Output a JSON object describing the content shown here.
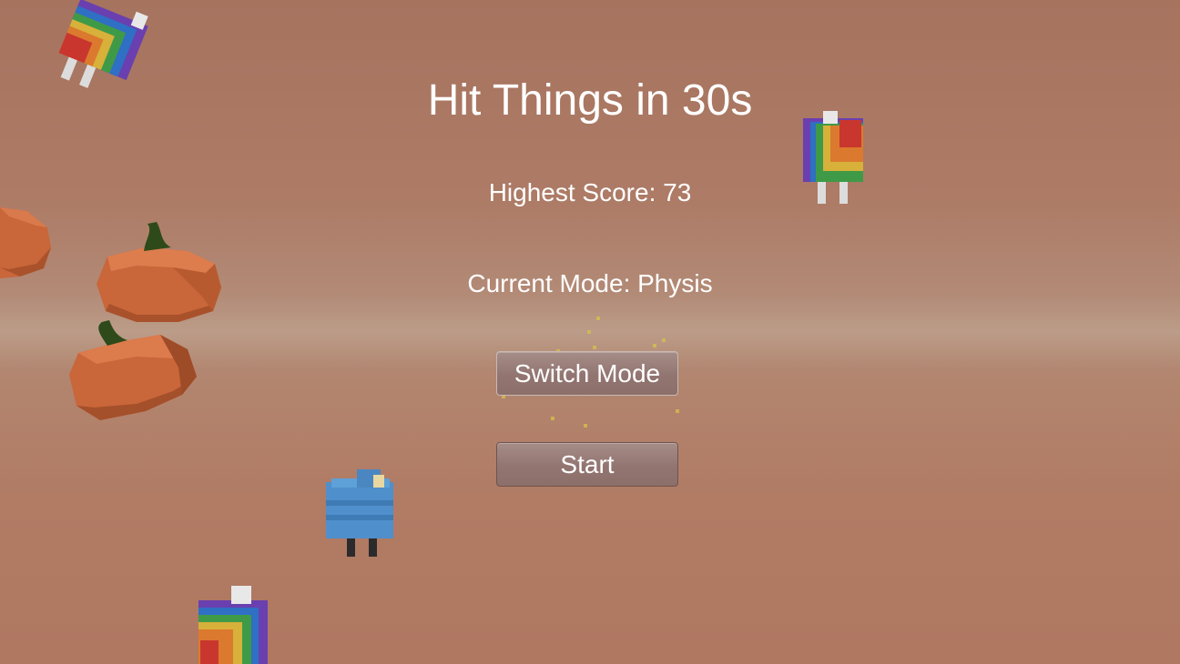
{
  "game": {
    "title": "Hit Things in 30s",
    "highest_score_text": "Highest Score: 73",
    "current_mode_text": "Current Mode: Physis",
    "switch_mode_label": "Switch Mode",
    "start_label": "Start"
  },
  "scene_objects": [
    {
      "name": "rainbow-creature",
      "count": 3
    },
    {
      "name": "blue-creature",
      "count": 1
    },
    {
      "name": "pumpkin",
      "count": 3
    }
  ],
  "colors": {
    "background": "#b07b65",
    "text": "#ffffff",
    "button": "#957a75",
    "pumpkin": "#c9663a"
  }
}
